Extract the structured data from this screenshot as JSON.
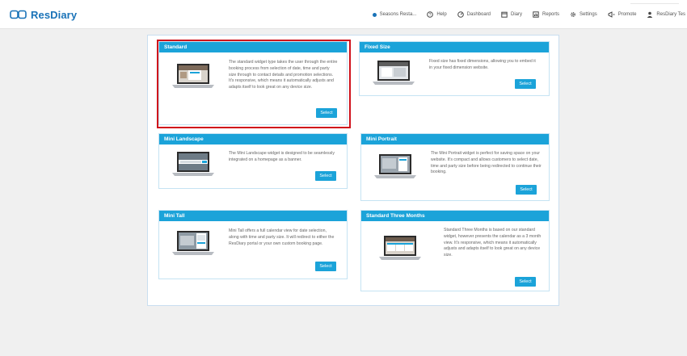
{
  "brand": {
    "name": "ResDiary",
    "color": "#1a73b8"
  },
  "nav": {
    "venue": "Seasons Resta...",
    "help": "Help",
    "dashboard": "Dashboard",
    "diary": "Diary",
    "reports": "Reports",
    "settings": "Settings",
    "promote": "Promote",
    "user": "ResDiary Tes"
  },
  "colors": {
    "accent": "#1ba3d9",
    "highlight": "#d0121b"
  },
  "cards": [
    {
      "title": "Standard",
      "description": "The standard widget type takes the user through the entire booking process from selection of date, time and party size through to contact details and promotion selections. It's responsive, which means it automatically adjusts and adapts itself to look great on any device size.",
      "button": "Select",
      "selected": true
    },
    {
      "title": "Fixed Size",
      "description": "Fixed size has fixed dimensions, allowing you to embed it in your fixed dimension website.",
      "button": "Select"
    },
    {
      "title": "Mini Landscape",
      "description": "The Mini Landscape widget is designed to be seamlessly integrated on a homepage as a banner.",
      "button": "Select"
    },
    {
      "title": "Mini Portrait",
      "description": "The Mini Portrait widget is perfect for saving space on your website. It's compact and allows customers to select date, time and party size before being redirected to continue their booking.",
      "button": "Select"
    },
    {
      "title": "Mini Tall",
      "description": "Mini Tall offers a full calendar view for date selection, along with time and party size. It will redirect to either the ResDiary portal or your own custom booking page.",
      "button": "Select"
    },
    {
      "title": "Standard Three Months",
      "description": "Standard Three Months is based on our standard widget, however presents the calendar as a 3 month view. It's responsive, which means it automatically adjusts and adapts itself to look great on any device size.",
      "button": "Select"
    }
  ]
}
